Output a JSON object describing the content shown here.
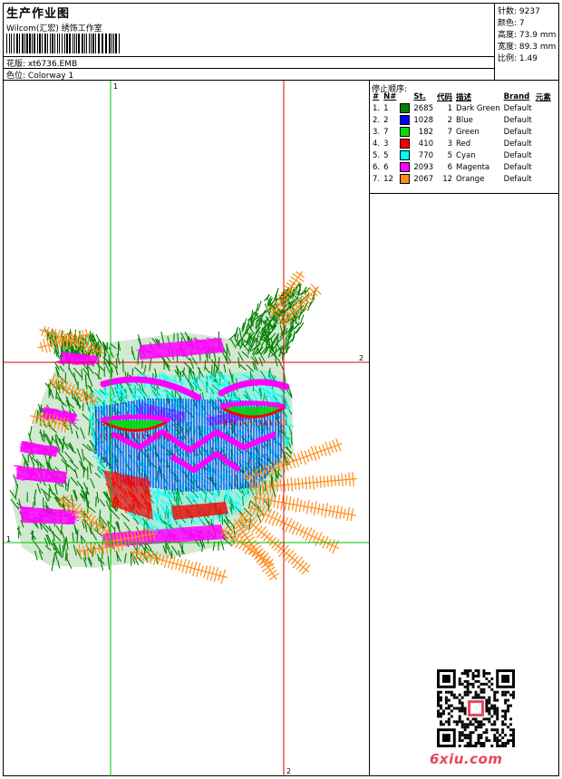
{
  "header": {
    "title": "生产作业图",
    "company": "Wilcom(汇宏) 绣饰工作室",
    "design_label": "花版:",
    "design_value": "xt6736.EMB",
    "colorway_label": "色位:",
    "colorway_value": "Colorway 1"
  },
  "stats": [
    {
      "label": "针数:",
      "value": "9237"
    },
    {
      "label": "颜色:",
      "value": "7"
    },
    {
      "label": "高度:",
      "value": "73.9 mm"
    },
    {
      "label": "宽度:",
      "value": "89.3 mm"
    },
    {
      "label": "比例:",
      "value": "1.49"
    }
  ],
  "stop_panel": {
    "title": "停止顺序:",
    "columns": [
      "#",
      "N#",
      "St.",
      "代码",
      "描述",
      "Brand",
      "元素"
    ],
    "rows": [
      {
        "idx": "1.",
        "n": "1",
        "color": "#008000",
        "st": "2685",
        "code": "1",
        "desc": "Dark Green",
        "brand": "Default"
      },
      {
        "idx": "2.",
        "n": "2",
        "color": "#0000ff",
        "st": "1028",
        "code": "2",
        "desc": "Blue",
        "brand": "Default"
      },
      {
        "idx": "3.",
        "n": "7",
        "color": "#00e000",
        "st": "182",
        "code": "7",
        "desc": "Green",
        "brand": "Default"
      },
      {
        "idx": "4.",
        "n": "3",
        "color": "#ff0000",
        "st": "410",
        "code": "3",
        "desc": "Red",
        "brand": "Default"
      },
      {
        "idx": "5.",
        "n": "5",
        "color": "#00ffff",
        "st": "770",
        "code": "5",
        "desc": "Cyan",
        "brand": "Default"
      },
      {
        "idx": "6.",
        "n": "6",
        "color": "#ff00ff",
        "st": "2093",
        "code": "6",
        "desc": "Magenta",
        "brand": "Default"
      },
      {
        "idx": "7.",
        "n": "12",
        "color": "#ff8c1a",
        "st": "2067",
        "code": "12",
        "desc": "Orange",
        "brand": "Default"
      }
    ]
  },
  "canvas": {
    "guide_green": "#00c000",
    "guide_red": "#e00000",
    "labels": {
      "v_green": "1",
      "h_red": "2",
      "h_green": "1",
      "v_red": "2"
    }
  },
  "footer": {
    "site": "6xiu.com"
  }
}
